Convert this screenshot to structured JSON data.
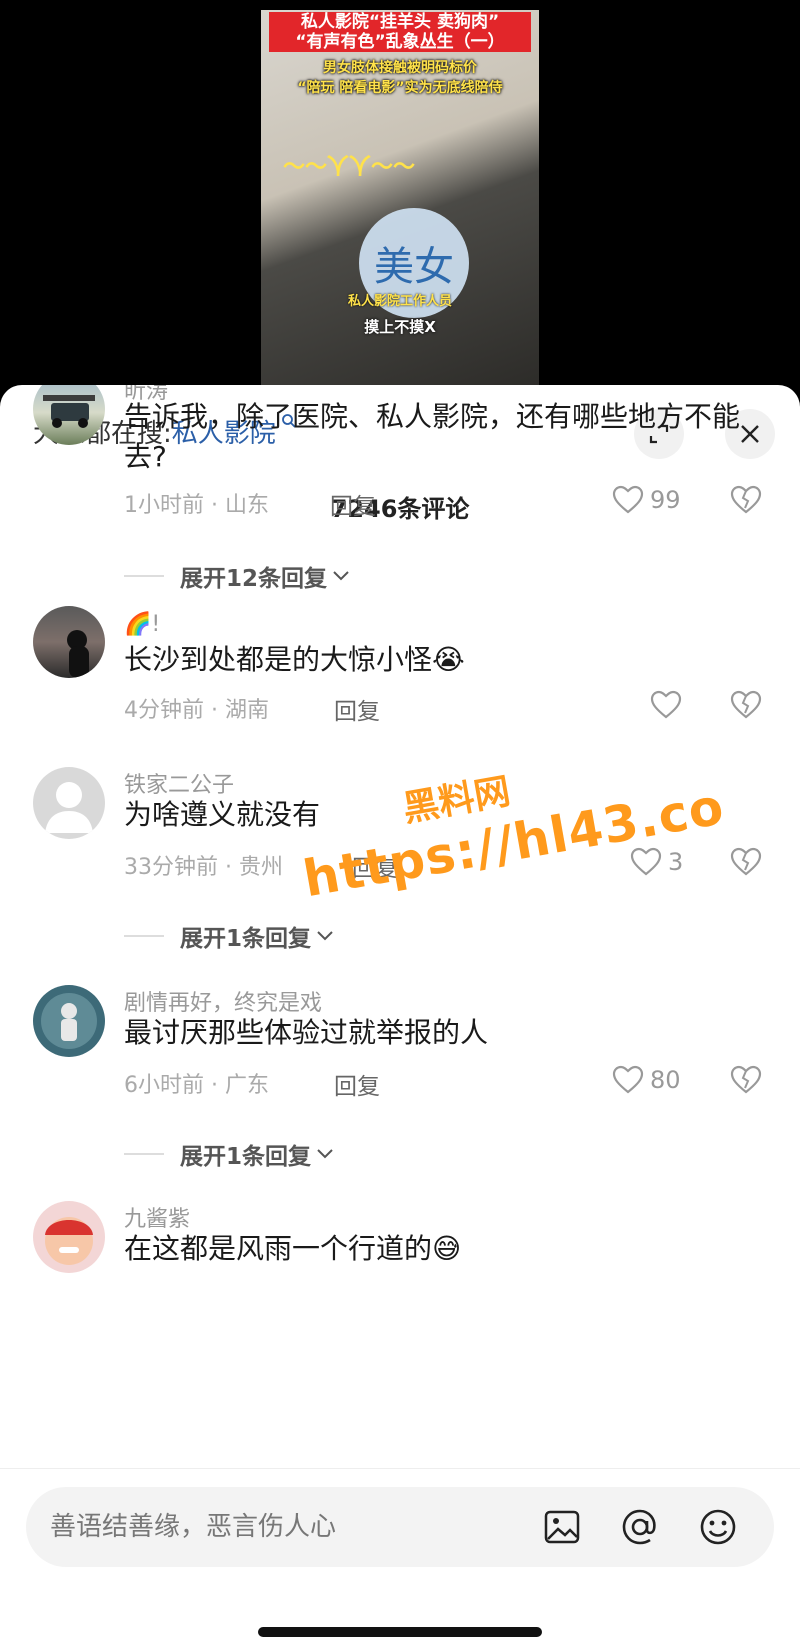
{
  "video": {
    "title_line1": "私人影院“挂羊头 卖狗肉”",
    "title_line2": "“有声有色”乱象丛生（一）",
    "subtitle_line1": "男女肢体接触被明码标价",
    "subtitle_line2": "“陪玩 陪看电影”实为无底线陪侍",
    "overlay_marks": "～～人人～～",
    "circle_text": "美女",
    "person_label": "私人影院工作人员",
    "caption": "摸上不摸X"
  },
  "sheet": {
    "search_prefix": "大家都在搜:",
    "search_keyword": "私人影院",
    "comment_count": "7246条评论",
    "expand_icon": "expand-icon",
    "close_icon": "close-icon"
  },
  "comments": [
    {
      "username": "昕涛",
      "text": "告诉我，除了医院、私人影院，还有哪些地方不能去?",
      "time": "1小时前",
      "location": "山东",
      "reply_label": "回复",
      "likes": "99",
      "expand_label": "展开12条回复"
    },
    {
      "username": "🌈!",
      "text": "长沙到处都是的大惊小怪😭",
      "time": "4分钟前",
      "location": "湖南",
      "reply_label": "回复",
      "likes": ""
    },
    {
      "username": "铁家二公子",
      "text": "为啥遵义就没有",
      "time": "33分钟前",
      "location": "贵州",
      "reply_label": "回复",
      "likes": "3",
      "expand_label": "展开1条回复"
    },
    {
      "username": "剧情再好，终究是戏",
      "text": "最讨厌那些体验过就举报的人",
      "time": "6小时前",
      "location": "广东",
      "reply_label": "回复",
      "likes": "80",
      "expand_label": "展开1条回复"
    },
    {
      "username": "九酱紫",
      "text": "在这都是风雨一个行道的😅",
      "time": "",
      "location": "",
      "reply_label": "",
      "likes": ""
    }
  ],
  "watermark": {
    "line1": "黑料网",
    "line2": "https://hl43.co"
  },
  "input": {
    "placeholder": "善语结善缘，恶言伤人心",
    "icons": [
      "image-icon",
      "at-icon",
      "emoji-icon"
    ]
  }
}
